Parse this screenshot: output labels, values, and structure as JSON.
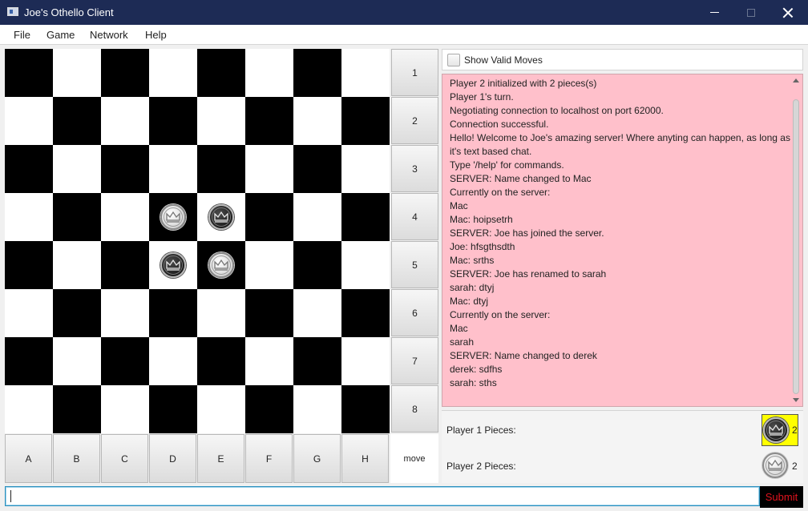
{
  "window": {
    "title": "Joe's Othello Client"
  },
  "menu": [
    "File",
    "Game",
    "Network",
    "Help"
  ],
  "board": {
    "rows": [
      "1",
      "2",
      "3",
      "4",
      "5",
      "6",
      "7",
      "8"
    ],
    "columns": [
      "A",
      "B",
      "C",
      "D",
      "E",
      "F",
      "G",
      "H"
    ],
    "corner_label": "move",
    "pieces": [
      {
        "cell": "D4",
        "color": "white"
      },
      {
        "cell": "E4",
        "color": "black"
      },
      {
        "cell": "D5",
        "color": "black"
      },
      {
        "cell": "E5",
        "color": "white"
      }
    ]
  },
  "options": {
    "show_valid_moves_label": "Show Valid Moves",
    "show_valid_moves_checked": false
  },
  "chat": {
    "lines": [
      "Player 2 initialized with 2 pieces(s)",
      "Player 1's turn.",
      "Negotiating connection to localhost on port 62000.",
      "Connection successful.",
      "Hello! Welcome to Joe's amazing server! Where anyting can happen, as long as",
      "it's text based chat.",
      "Type '/help' for commands.",
      "SERVER: Name changed to Mac",
      "Currently on the server:",
      "Mac",
      "Mac: hoipsetrh",
      "SERVER: Joe has joined the server.",
      "Joe: hfsgthsdth",
      "Mac: srths",
      "SERVER: Joe has renamed to sarah",
      "sarah: dtyj",
      "Mac: dtyj",
      "Currently on the server:",
      "Mac",
      "sarah",
      "SERVER: Name changed to derek",
      "derek: sdfhs",
      "sarah: sths"
    ],
    "background": "#ffc0cb",
    "input_value": "",
    "submit_label": "Submit"
  },
  "players": {
    "p1_label": "Player 1 Pieces:",
    "p1_count": "2",
    "p1_color": "black",
    "p2_label": "Player 2 Pieces:",
    "p2_count": "2",
    "p2_color": "white",
    "active_player_highlight": "#ffff00"
  }
}
